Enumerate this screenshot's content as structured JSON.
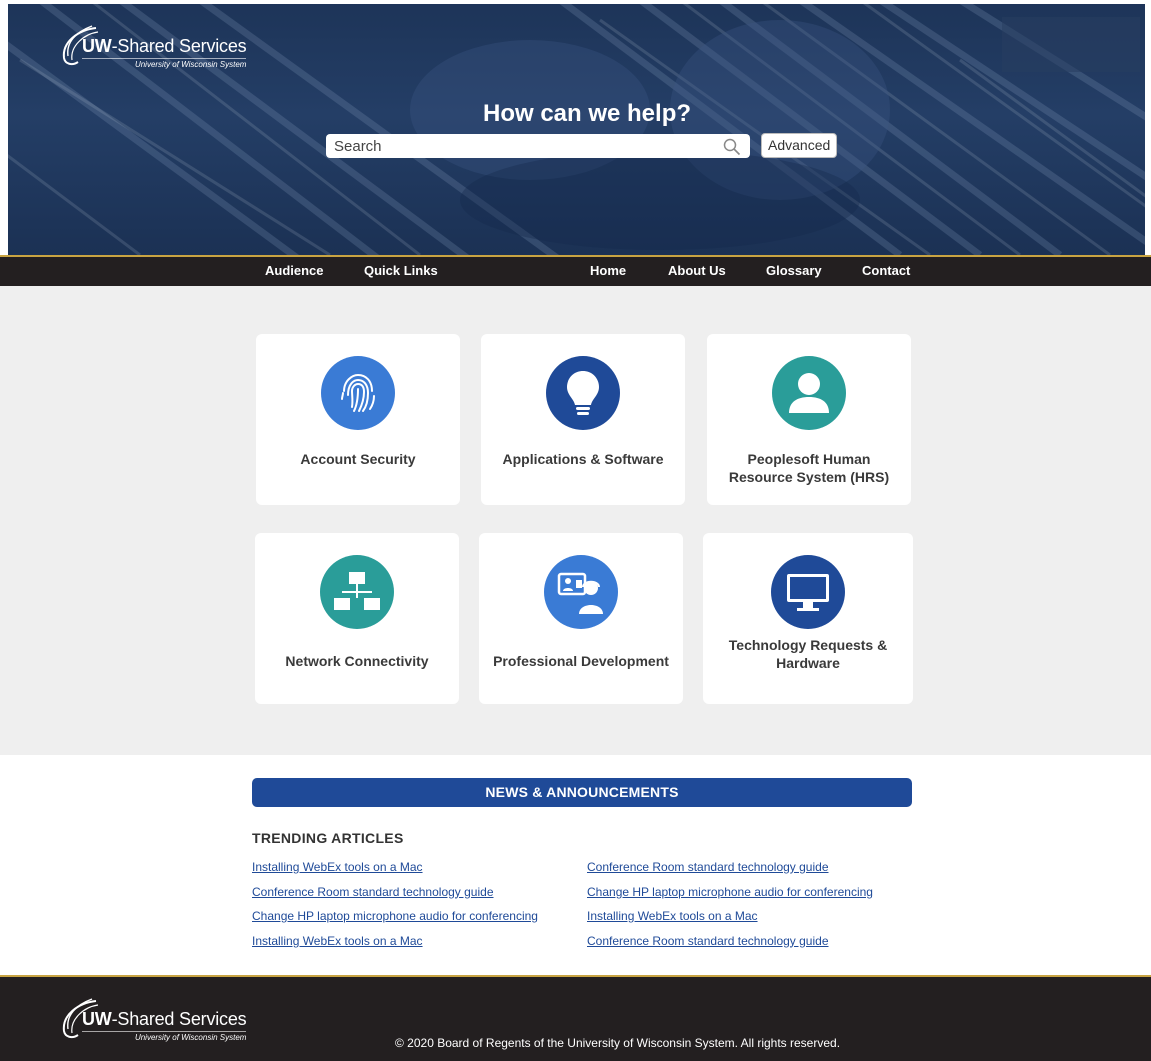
{
  "brand": {
    "name_bold": "UW",
    "name_rest": "-Shared Services",
    "subtitle": "University of Wisconsin System"
  },
  "hero": {
    "title": "How can we help?",
    "search_placeholder": "Search",
    "advanced_label": "Advanced"
  },
  "nav": {
    "items": [
      "Audience",
      "Quick Links",
      "Home",
      "About Us",
      "Glossary",
      "Contact"
    ]
  },
  "tiles": [
    {
      "label": "Account Security",
      "icon": "fingerprint-icon",
      "color": "#3a7bd5"
    },
    {
      "label": "Applications & Software",
      "icon": "lightbulb-icon",
      "color": "#1f4a98"
    },
    {
      "label": "Peoplesoft Human Resource System (HRS)",
      "icon": "user-icon",
      "color": "#2a9d99"
    },
    {
      "label": "Network Connectivity",
      "icon": "network-icon",
      "color": "#2a9d99"
    },
    {
      "label": "Professional Development",
      "icon": "video-conference-icon",
      "color": "#3a7bd5"
    },
    {
      "label": "Technology Requests & Hardware",
      "icon": "monitor-icon",
      "color": "#1f4a98"
    }
  ],
  "news": {
    "banner": "NEWS & ANNOUNCEMENTS",
    "trending_title": "TRENDING ARTICLES",
    "left_articles": [
      "Installing WebEx tools on a Mac",
      "Conference Room standard technology guide",
      "Change HP laptop microphone audio for conferencing",
      "Installing WebEx tools on a Mac"
    ],
    "right_articles": [
      "Conference Room standard technology guide",
      "Change HP laptop microphone audio for conferencing",
      "Installing WebEx tools on a Mac",
      "Conference Room standard technology guide"
    ]
  },
  "footer": {
    "copyright": "© 2020 Board of Regents of the University of Wisconsin System. All rights reserved."
  },
  "colors": {
    "nav_bg": "#231f20",
    "accent_gold": "#c8a442",
    "brand_blue": "#1f4a98",
    "tile_bg": "#efefef"
  }
}
